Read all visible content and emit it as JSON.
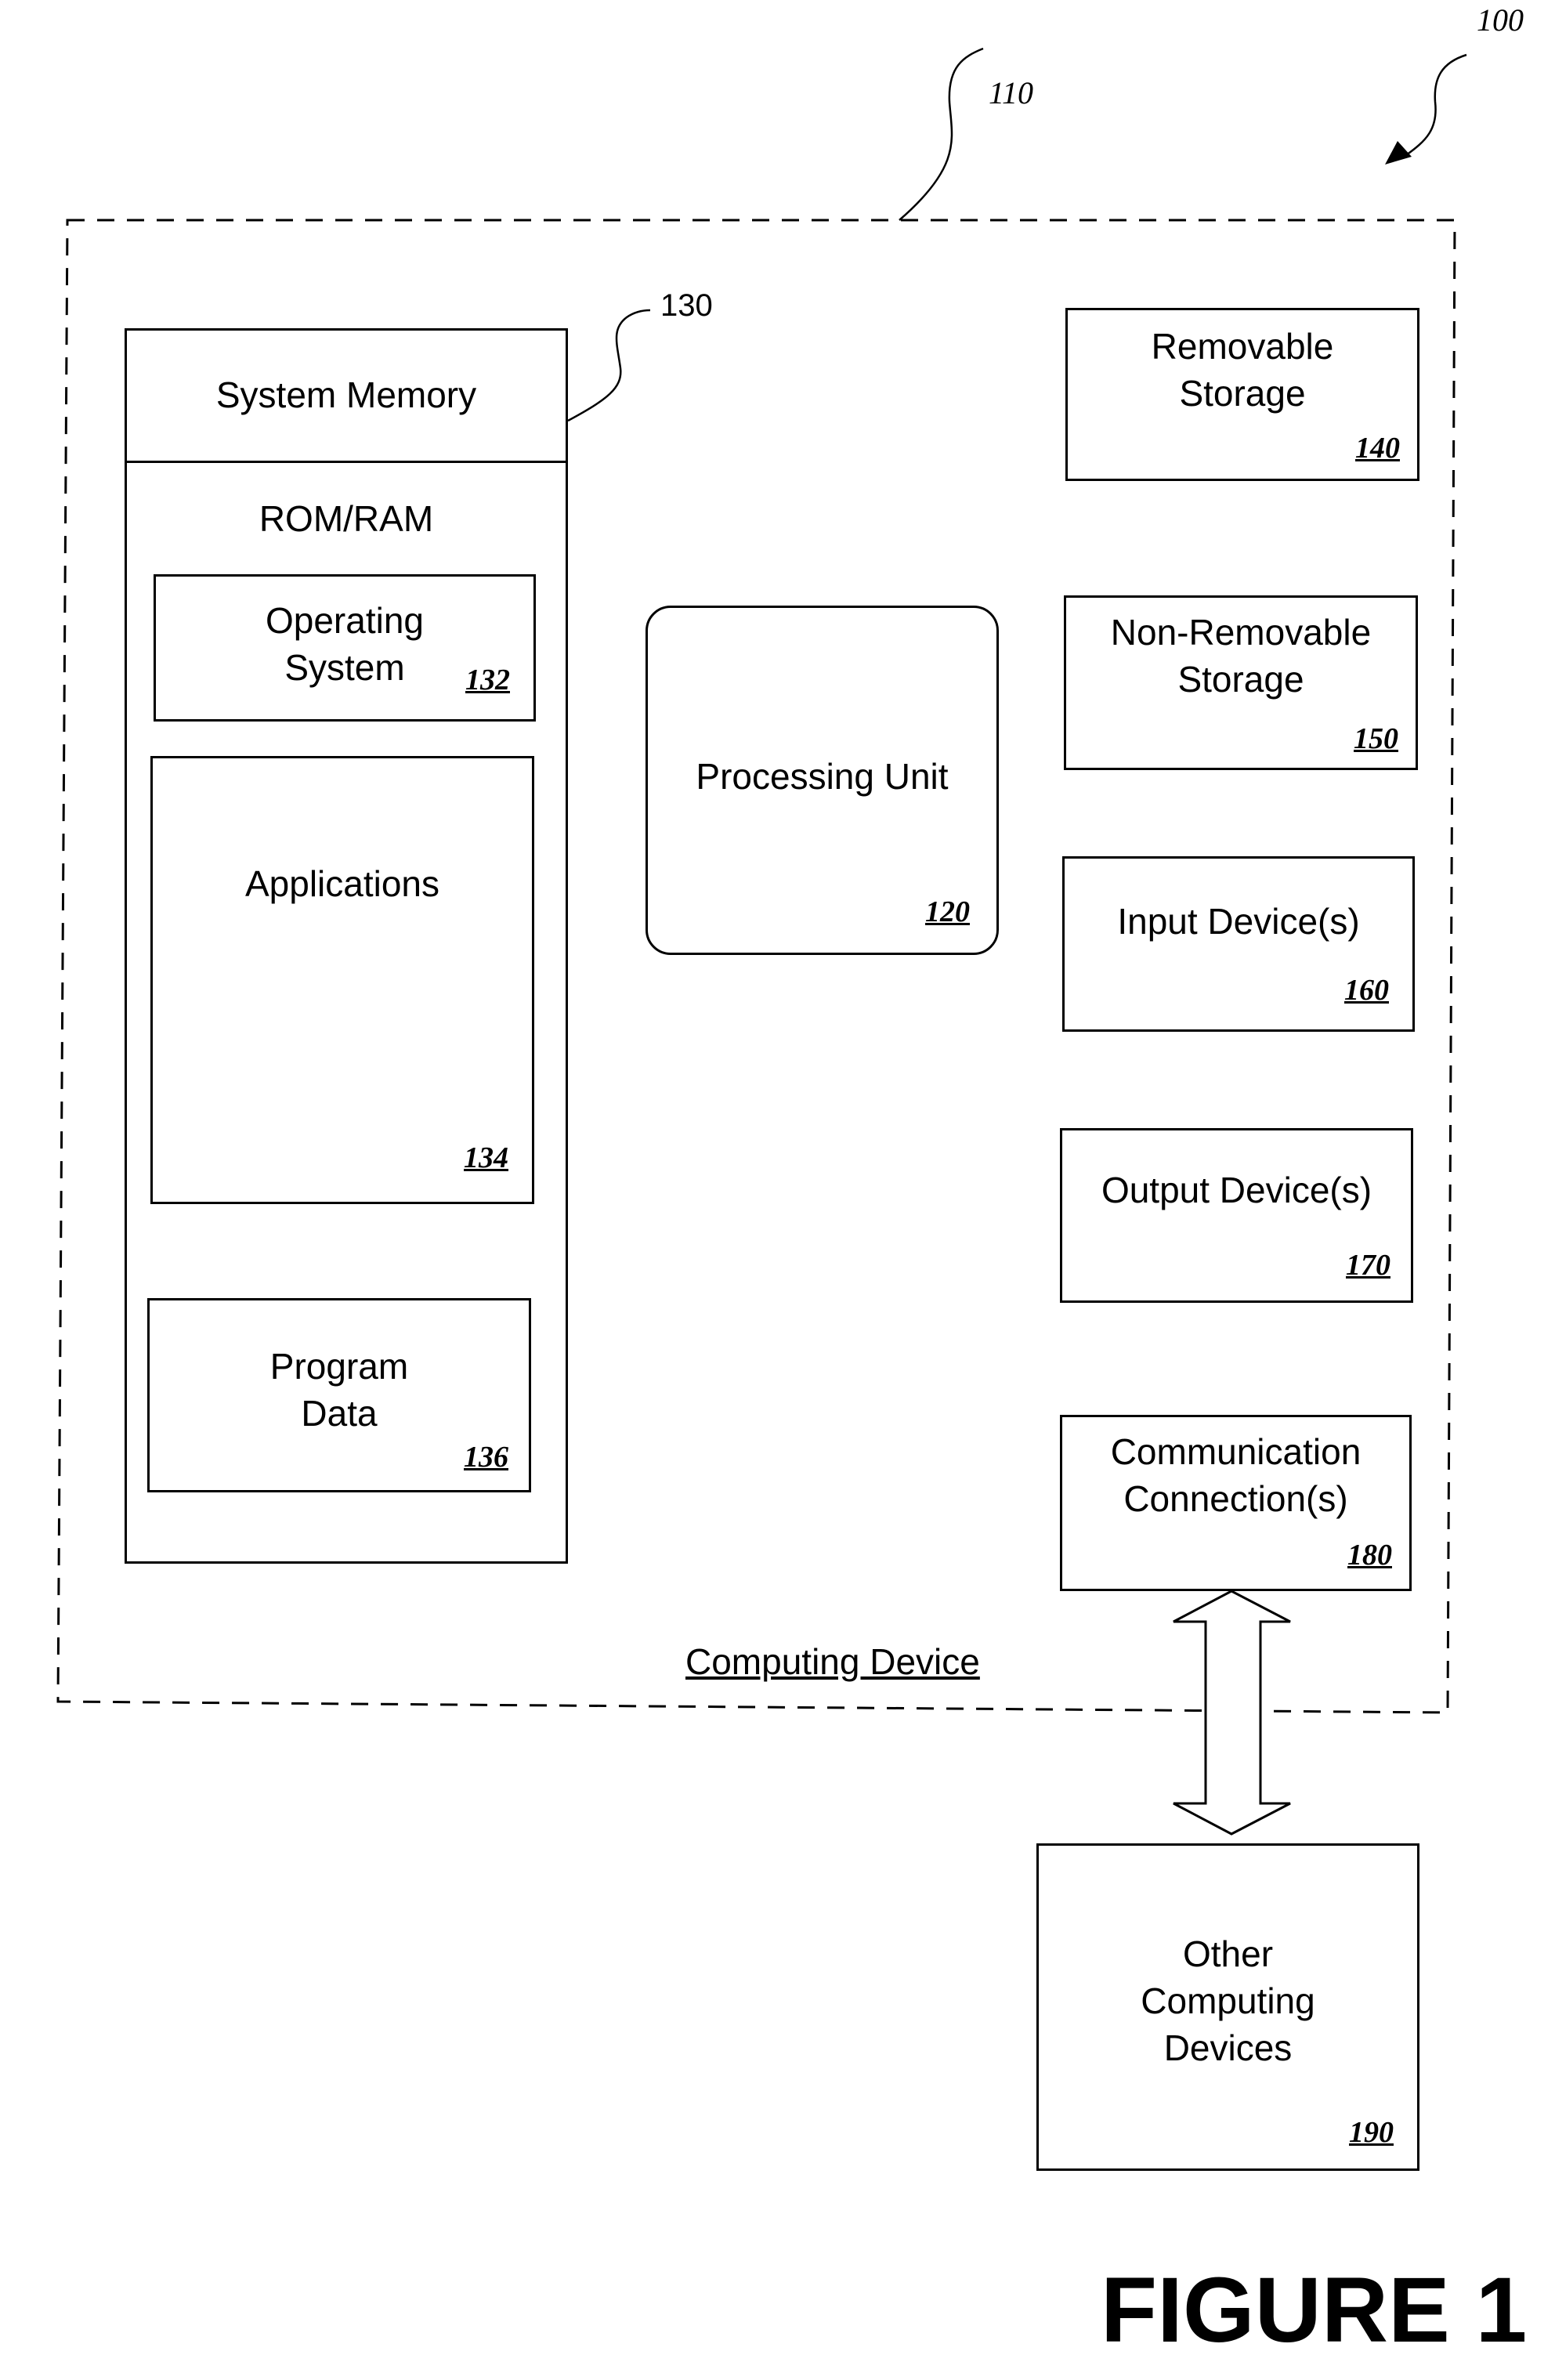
{
  "figure": {
    "title": "FIGURE 1",
    "system_ref": "100",
    "device_ref": "110",
    "device_caption": "Computing Device"
  },
  "system_memory": {
    "ref": "130",
    "title": "System Memory",
    "subtitle": "ROM/RAM",
    "operating_system": {
      "label": "Operating\nSystem",
      "ref": "132"
    },
    "applications": {
      "label": "Applications",
      "ref": "134"
    },
    "program_data": {
      "label": "Program\nData",
      "ref": "136"
    }
  },
  "processing_unit": {
    "label": "Processing Unit",
    "ref": "120"
  },
  "components": [
    {
      "label": "Removable\nStorage",
      "ref": "140"
    },
    {
      "label": "Non-Removable\nStorage",
      "ref": "150"
    },
    {
      "label": "Input Device(s)",
      "ref": "160"
    },
    {
      "label": "Output Device(s)",
      "ref": "170"
    },
    {
      "label": "Communication\nConnection(s)",
      "ref": "180"
    }
  ],
  "other_devices": {
    "label": "Other\nComputing\nDevices",
    "ref": "190"
  },
  "connection": {
    "type": "bidirectional-arrow",
    "from": "180",
    "to": "190"
  }
}
